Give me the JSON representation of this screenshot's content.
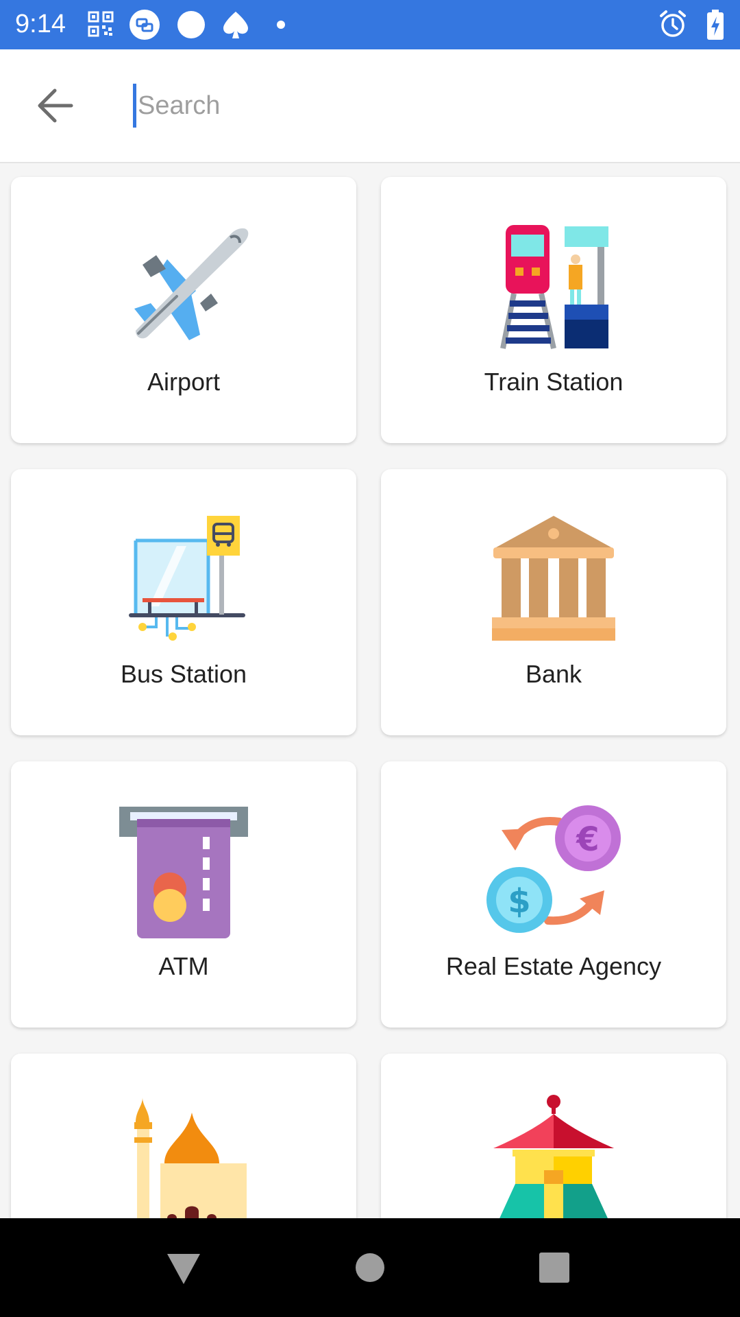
{
  "status_bar": {
    "time": "9:14",
    "left_icons": [
      "qr-code-icon",
      "chat-bubble-icon",
      "circle-icon",
      "spade-icon",
      "dot-icon"
    ],
    "right_icons": [
      "alarm-clock-icon",
      "battery-charging-icon"
    ],
    "background": "#3577e0"
  },
  "search": {
    "placeholder": "Search",
    "value": "",
    "back_icon": "arrow-back-icon"
  },
  "categories": [
    {
      "label": "Airport",
      "icon": "airplane-icon"
    },
    {
      "label": "Train Station",
      "icon": "train-station-icon"
    },
    {
      "label": "Bus Station",
      "icon": "bus-stop-icon"
    },
    {
      "label": "Bank",
      "icon": "bank-building-icon"
    },
    {
      "label": "ATM",
      "icon": "atm-card-icon"
    },
    {
      "label": "Real Estate Agency",
      "icon": "currency-exchange-icon"
    },
    {
      "label": "",
      "icon": "mosque-icon"
    },
    {
      "label": "",
      "icon": "pagoda-temple-icon"
    }
  ],
  "nav_bar": {
    "buttons": [
      "back-triangle-icon",
      "home-circle-icon",
      "recents-square-icon"
    ]
  }
}
